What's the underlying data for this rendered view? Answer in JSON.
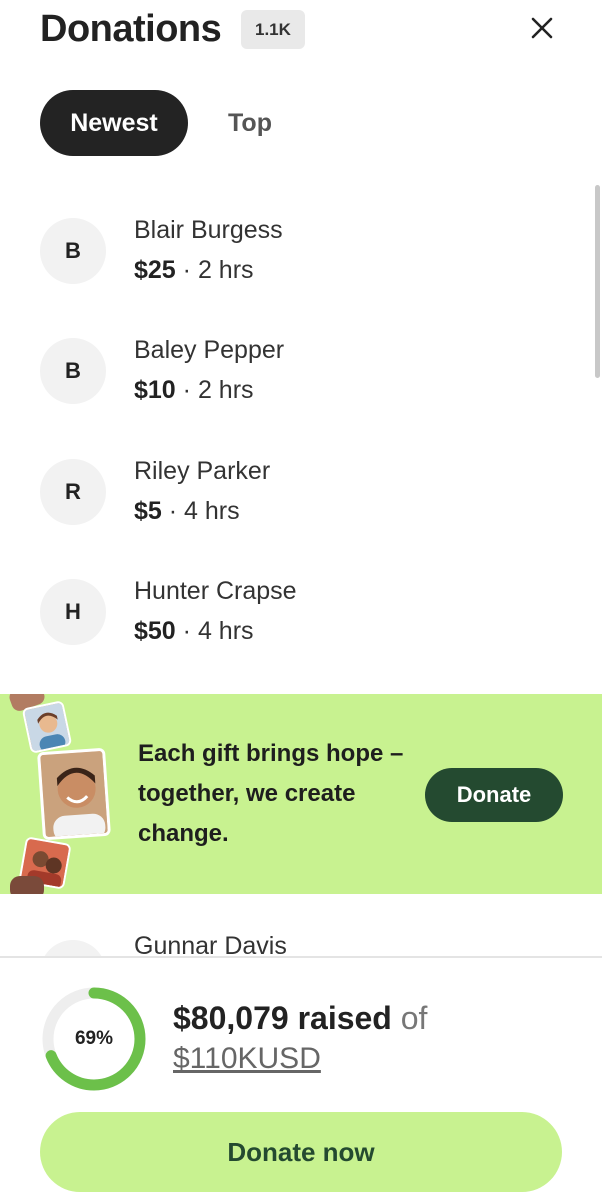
{
  "header": {
    "title": "Donations",
    "count": "1.1K",
    "close_icon": "close-icon"
  },
  "tabs": [
    {
      "label": "Newest",
      "active": true
    },
    {
      "label": "Top",
      "active": false
    }
  ],
  "donations": [
    {
      "initial": "B",
      "name": "Blair Burgess",
      "amount": "$25",
      "time": "2 hrs"
    },
    {
      "initial": "B",
      "name": "Baley Pepper",
      "amount": "$10",
      "time": "2 hrs"
    },
    {
      "initial": "R",
      "name": "Riley Parker",
      "amount": "$5",
      "time": "4 hrs"
    },
    {
      "initial": "H",
      "name": "Hunter Crapse",
      "amount": "$50",
      "time": "4 hrs"
    }
  ],
  "separator": " · ",
  "promo": {
    "text": "Each gift brings hope – together, we create change.",
    "button_label": "Donate",
    "background_color": "#c8f290",
    "button_color": "#244a30"
  },
  "peek_donor": {
    "name": "Gunnar Davis"
  },
  "progress": {
    "percent_label": "69%",
    "percent": 69,
    "raised": "$80,079 raised",
    "of": " of",
    "goal": "$110KUSD",
    "ring_color": "#6cc04a",
    "track_color": "#eeeeee"
  },
  "footer": {
    "donate_now_label": "Donate now"
  }
}
